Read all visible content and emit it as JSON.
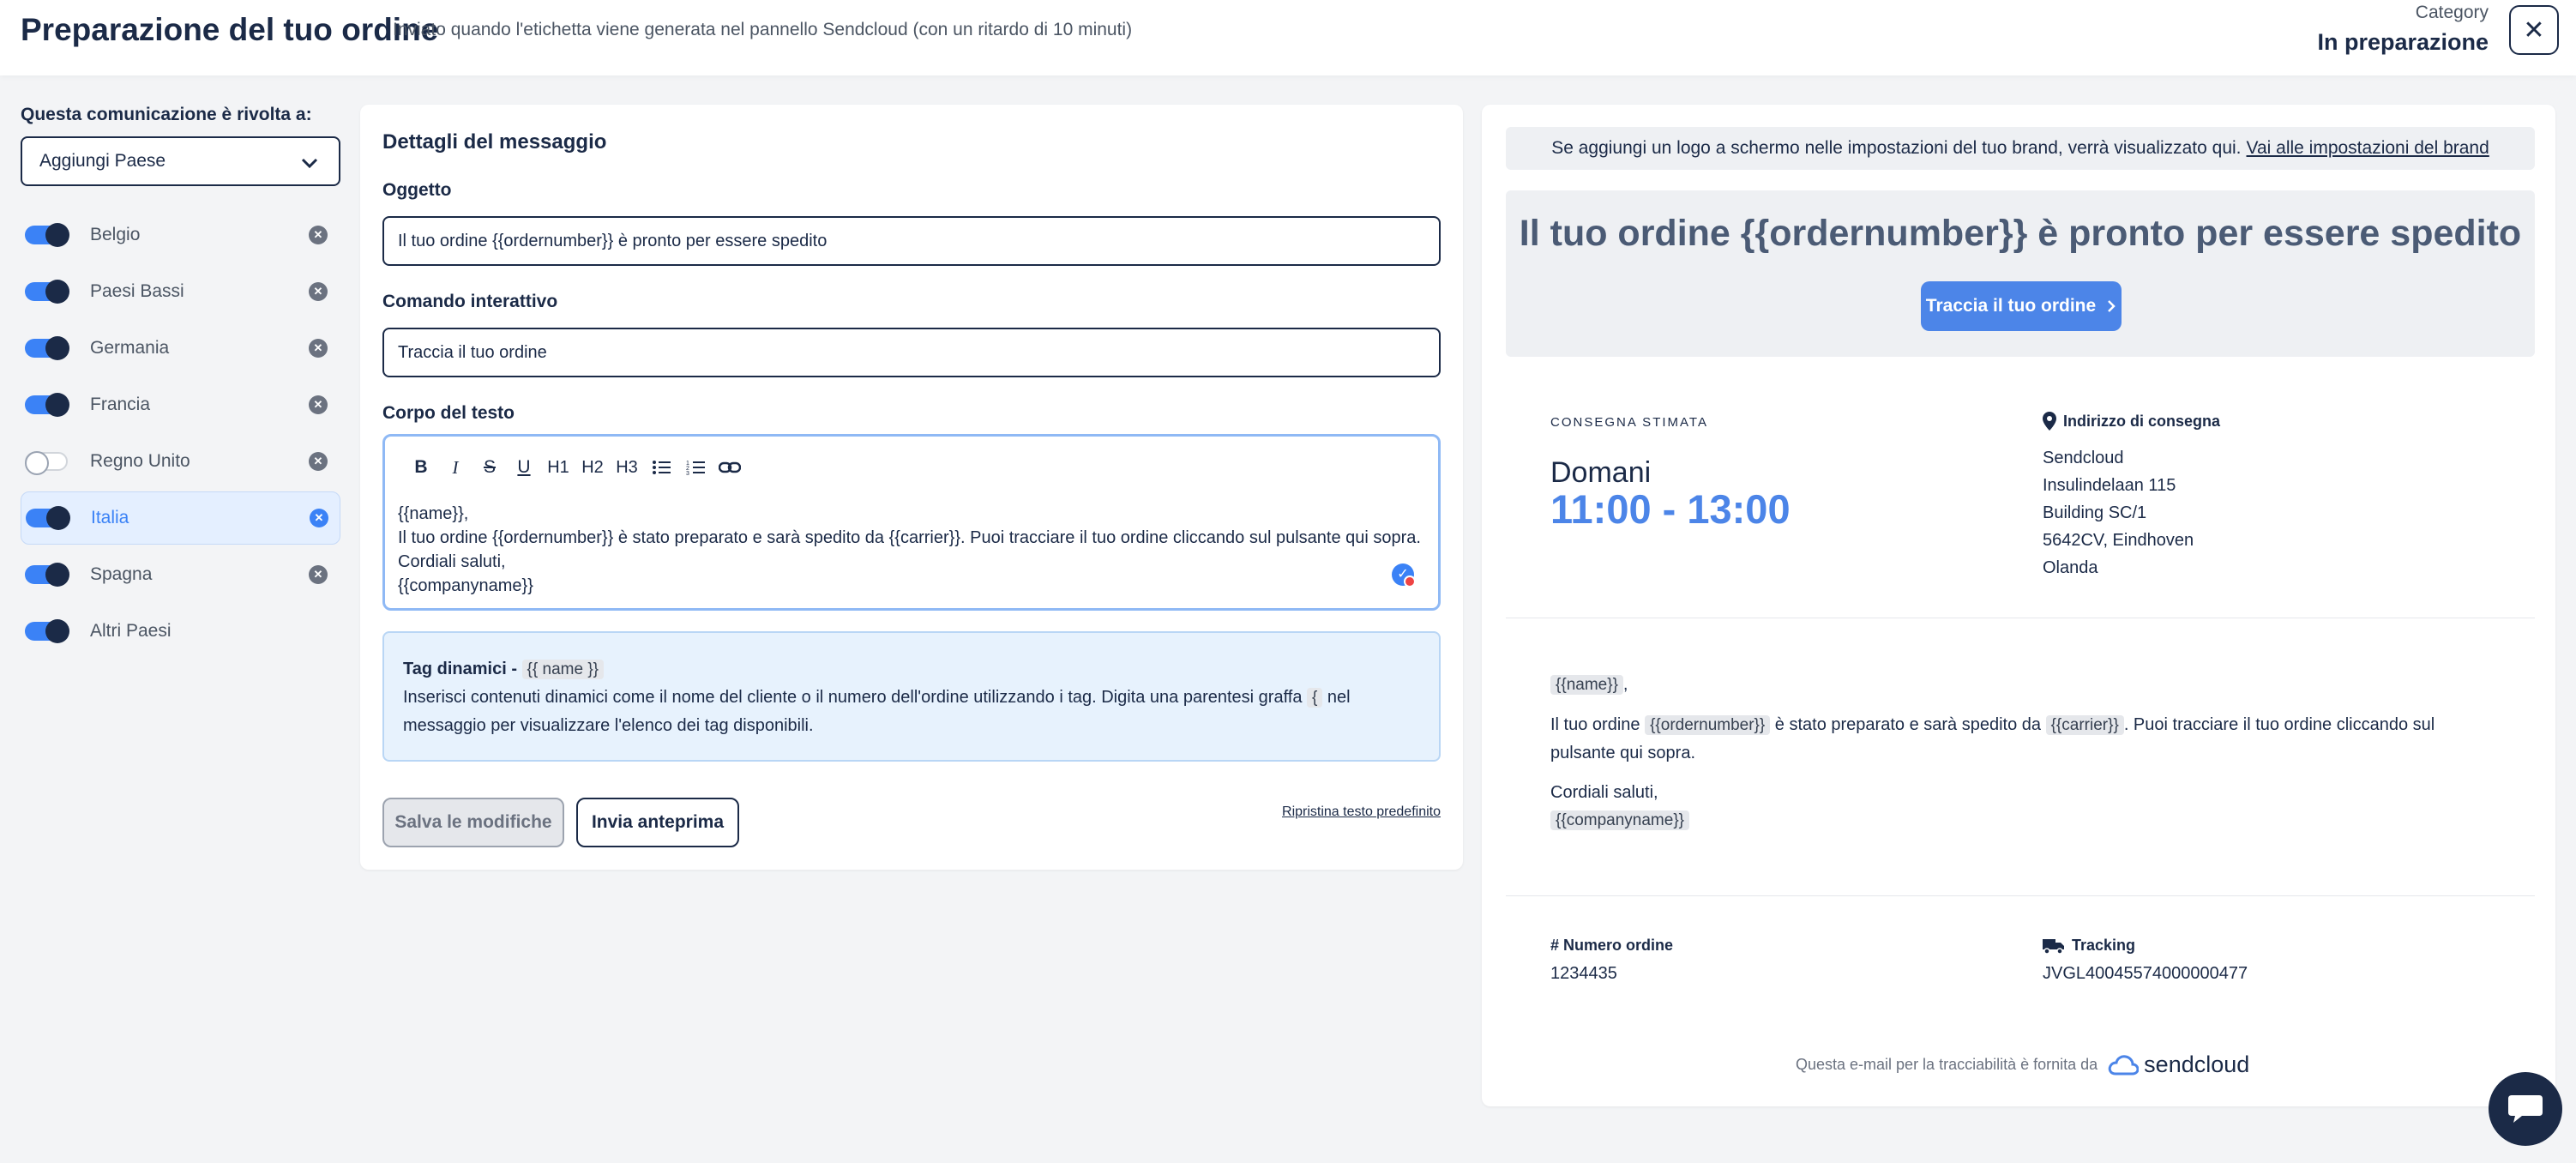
{
  "header": {
    "title": "Preparazione del tuo ordine",
    "subtitle": "Inviato quando l'etichetta viene generata nel pannello Sendcloud (con un ritardo di 10 minuti)",
    "category_label": "Category",
    "category_value": "In preparazione",
    "close_icon": "close-icon"
  },
  "audience": {
    "label": "Questa comunicazione è rivolta a:",
    "select_value": "Aggiungi Paese",
    "countries": [
      {
        "name": "Belgio",
        "enabled": true,
        "removable": true,
        "active": false
      },
      {
        "name": "Paesi Bassi",
        "enabled": true,
        "removable": true,
        "active": false
      },
      {
        "name": "Germania",
        "enabled": true,
        "removable": true,
        "active": false
      },
      {
        "name": "Francia",
        "enabled": true,
        "removable": true,
        "active": false
      },
      {
        "name": "Regno Unito",
        "enabled": false,
        "removable": true,
        "active": false
      },
      {
        "name": "Italia",
        "enabled": true,
        "removable": true,
        "active": true
      },
      {
        "name": "Spagna",
        "enabled": true,
        "removable": true,
        "active": false
      },
      {
        "name": "Altri Paesi",
        "enabled": true,
        "removable": false,
        "active": false
      }
    ]
  },
  "message": {
    "title": "Dettagli del messaggio",
    "subject_label": "Oggetto",
    "subject_value": "Il tuo ordine {{ordernumber}} è pronto per essere spedito",
    "cta_label": "Comando interattivo",
    "cta_value": "Traccia il tuo ordine",
    "body_label": "Corpo del testo",
    "toolbar": {
      "h1": "H1",
      "h2": "H2",
      "h3": "H3"
    },
    "body_lines": [
      "{{name}},",
      "Il tuo ordine {{ordernumber}} è stato preparato e sarà spedito da {{carrier}}. Puoi tracciare il tuo ordine cliccando sul pulsante qui sopra.",
      "Cordiali saluti,",
      "{{companyname}}"
    ],
    "tags_title": "Tag dinamici - ",
    "tags_example": "{{ name }}",
    "tags_text_1": "Inserisci contenuti dinamici come il nome del cliente o il numero dell'ordine utilizzando i tag. Digita una parentesi graffa ",
    "tags_brace": "{",
    "tags_text_2": " nel messaggio per visualizzare l'elenco dei tag disponibili.",
    "save_label": "Salva le modifiche",
    "preview_label": "Invia anteprima",
    "reset_label": "Ripristina testo predefinito"
  },
  "preview": {
    "logo_note": "Se aggiungi un logo a schermo nelle impostazioni del tuo brand, verrà visualizzato qui.",
    "logo_link": "Vai alle impostazioni del brand",
    "hero_title": "Il tuo ordine {{ordernumber}} è pronto per essere spedito",
    "track_button": "Traccia il tuo ordine",
    "delivery_label": "CONSEGNA STIMATA",
    "delivery_day": "Domani",
    "delivery_time": "11:00 - 13:00",
    "address_title": "Indirizzo di consegna",
    "address_lines": [
      "Sendcloud",
      "Insulindelaan 115",
      "Building SC/1",
      "5642CV, Eindhoven",
      "Olanda"
    ],
    "greeting_tag": "{{name}}",
    "greeting_suffix": ",",
    "body_1": "Il tuo ordine ",
    "tag_ordernumber": "{{ordernumber}}",
    "body_2": " è stato preparato e sarà spedito da ",
    "tag_carrier": "{{carrier}}",
    "body_3": ". Puoi tracciare il tuo ordine cliccando sul pulsante qui sopra.",
    "closing": "Cordiali saluti,",
    "tag_company": "{{companyname}}",
    "order_number_title": "# Numero ordine",
    "order_number_value": "1234435",
    "tracking_title": "Tracking",
    "tracking_value": "JVGL40045574000000477",
    "footer_text": "Questa e-mail per la tracciabilità è fornita da",
    "brand": "sendcloud"
  },
  "colors": {
    "accent": "#4c85e8",
    "navy": "#1b2a47",
    "info_bg": "#e7f2fd"
  }
}
